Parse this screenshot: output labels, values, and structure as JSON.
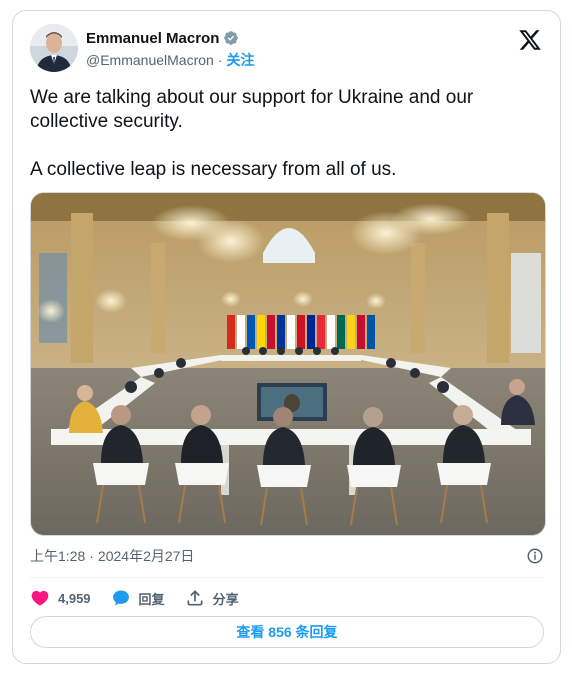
{
  "author": {
    "display_name": "Emmanuel Macron",
    "handle": "@EmmanuelMacron",
    "separator": "·",
    "follow_label": "关注",
    "verified_color": "#829aab"
  },
  "tweet": {
    "paragraphs": [
      "We are talking about our support for Ukraine and our collective security.",
      "A collective leap is necessary from all of us."
    ]
  },
  "meta": {
    "time": "上午1:28",
    "separator": "·",
    "date": "2024年2月27日"
  },
  "actions": {
    "likes_count": "4,959",
    "reply_label": "回复",
    "share_label": "分享"
  },
  "replies_button": {
    "label": "查看 856 条回复"
  },
  "colors": {
    "like": "#f91880",
    "reply": "#1d9bf0",
    "link": "#1d9bf0",
    "muted": "#536471"
  }
}
